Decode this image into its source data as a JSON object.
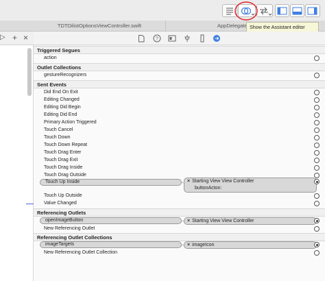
{
  "colors": {
    "accent": "#3f7fe0",
    "annotation": "#e0242c",
    "tooltip_bg": "#f7f7d8"
  },
  "toolbar": {
    "editor_buttons": [
      "standard-editor-icon",
      "assistant-editor-icon",
      "version-editor-icon"
    ],
    "view_buttons": [
      "navigator-toggle-icon",
      "debug-area-toggle-icon",
      "utilities-toggle-icon"
    ]
  },
  "tooltip": "Show the Assistant editor",
  "tabs": [
    "TDTOilistOptionsViewController.swift",
    "AppDelegate"
  ],
  "left_strip": {
    "add": "+",
    "close": "×",
    "back": "▷"
  },
  "inspector_icons": [
    "file-inspector-icon",
    "quick-help-icon",
    "identity-inspector-icon",
    "attributes-inspector-icon",
    "size-inspector-icon",
    "connections-inspector-icon"
  ],
  "sections": {
    "triggered_segues": {
      "title": "Triggered Segues",
      "rows": [
        "action"
      ]
    },
    "outlet_collections": {
      "title": "Outlet Collections",
      "rows": [
        "gestureRecognizers"
      ]
    },
    "sent_events": {
      "title": "Sent Events",
      "rows_before": [
        "Did End On Exit",
        "Editing Changed",
        "Editing Did Begin",
        "Editing Did End",
        "Primary Action Triggered",
        "Touch Cancel",
        "Touch Down",
        "Touch Down Repeat",
        "Touch Drag Enter",
        "Touch Drag Exit",
        "Touch Drag Inside",
        "Touch Drag Outside"
      ],
      "connected": {
        "event": "Touch Up Inside",
        "target_line1": "Starting View View Controller",
        "target_line2": "buttonActon:"
      },
      "rows_after": [
        "Touch Up Outside",
        "Value Changed"
      ]
    },
    "referencing_outlets": {
      "title": "Referencing Outlets",
      "connected": {
        "name": "openImageButton",
        "target": "Starting View View Controller"
      },
      "new_label": "New Referencing Outlet"
    },
    "referencing_outlet_collections": {
      "title": "Referencing Outlet Collections",
      "connected": {
        "name": "imageTargets",
        "target": "imageIcon"
      },
      "new_label": "New Referencing Outlet Collection"
    }
  }
}
